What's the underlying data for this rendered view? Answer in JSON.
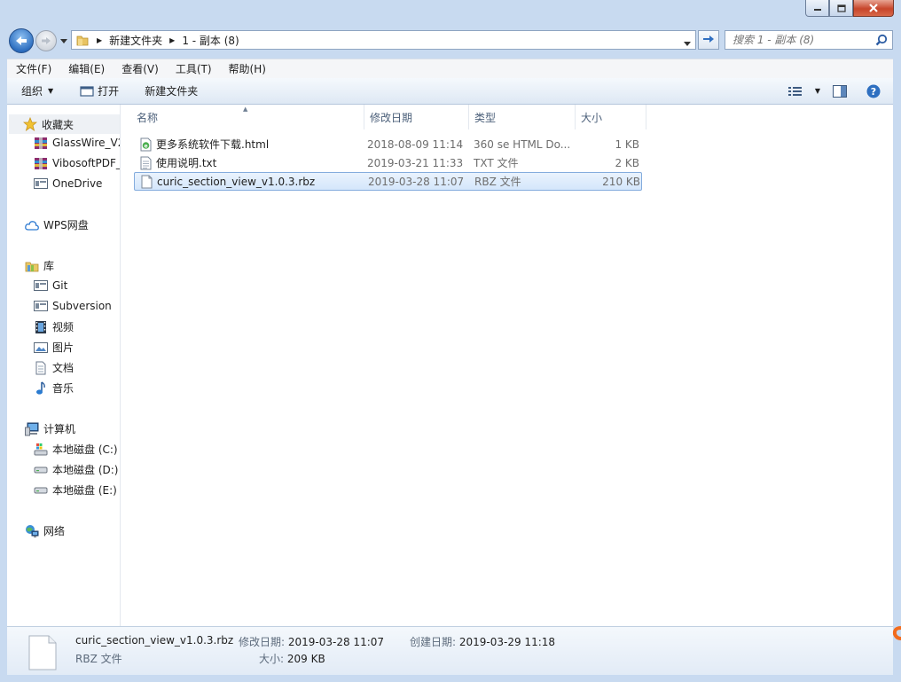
{
  "window": {
    "caption_buttons": [
      "minimize",
      "maximize",
      "close"
    ]
  },
  "address": {
    "crumbs": [
      "新建文件夹",
      "1 - 副本 (8)"
    ]
  },
  "search": {
    "placeholder": "搜索 1 - 副本 (8)"
  },
  "menu": {
    "items": [
      "文件(F)",
      "编辑(E)",
      "查看(V)",
      "工具(T)",
      "帮助(H)"
    ]
  },
  "toolbar": {
    "organize": "组织",
    "open": "打开",
    "new_folder": "新建文件夹"
  },
  "sidebar": {
    "favorites": {
      "label": "收藏夹",
      "icon": "star-icon"
    },
    "fav_items": [
      {
        "label": "GlassWire_V2",
        "icon": "winrar-icon"
      },
      {
        "label": "VibosoftPDF_",
        "icon": "winrar-icon"
      },
      {
        "label": "OneDrive",
        "icon": "library-icon"
      }
    ],
    "wps": {
      "label": "WPS网盘",
      "icon": "cloud-icon"
    },
    "libraries": {
      "label": "库",
      "icon": "library-folder-icon"
    },
    "lib_items": [
      {
        "label": "Git",
        "icon": "library-icon"
      },
      {
        "label": "Subversion",
        "icon": "library-icon"
      },
      {
        "label": "视频",
        "icon": "video-icon"
      },
      {
        "label": "图片",
        "icon": "picture-icon"
      },
      {
        "label": "文档",
        "icon": "document-icon"
      },
      {
        "label": "音乐",
        "icon": "music-icon"
      }
    ],
    "computer": {
      "label": "计算机",
      "icon": "computer-icon"
    },
    "drives": [
      {
        "label": "本地磁盘 (C:)",
        "icon": "system-drive-icon"
      },
      {
        "label": "本地磁盘 (D:)",
        "icon": "drive-icon"
      },
      {
        "label": "本地磁盘 (E:)",
        "icon": "drive-icon"
      }
    ],
    "network": {
      "label": "网络",
      "icon": "network-icon"
    }
  },
  "columns": [
    "名称",
    "修改日期",
    "类型",
    "大小"
  ],
  "files": [
    {
      "name": "更多系统软件下载.html",
      "modified": "2018-08-09 11:14",
      "type": "360 se HTML Do...",
      "size": "1 KB",
      "icon": "html-file-icon",
      "selected": false
    },
    {
      "name": "使用说明.txt",
      "modified": "2019-03-21 11:33",
      "type": "TXT 文件",
      "size": "2 KB",
      "icon": "text-file-icon",
      "selected": false
    },
    {
      "name": "curic_section_view_v1.0.3.rbz",
      "modified": "2019-03-28 11:07",
      "type": "RBZ 文件",
      "size": "210 KB",
      "icon": "blank-file-icon",
      "selected": true
    }
  ],
  "details": {
    "name": "curic_section_view_v1.0.3.rbz",
    "type": "RBZ 文件",
    "modified_label": "修改日期:",
    "modified": "2019-03-28 11:07",
    "created_label": "创建日期:",
    "created": "2019-03-29 11:18",
    "size_label": "大小:",
    "size": "209 KB"
  },
  "colors": {
    "frame": "#c8daf0",
    "selection_border": "#84acdd",
    "selection_fill": "#d4e6fb",
    "close_button": "#c7452b"
  }
}
